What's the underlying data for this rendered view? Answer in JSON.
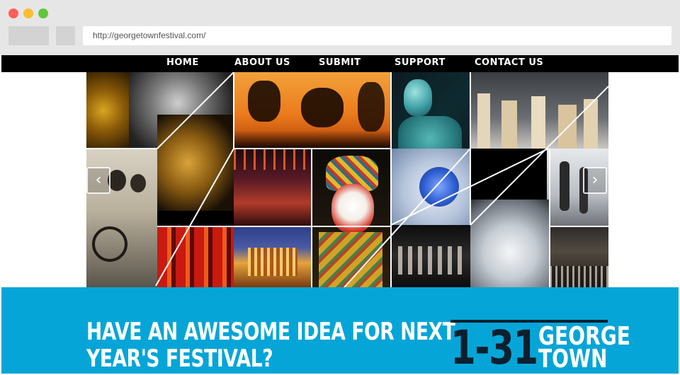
{
  "browser": {
    "url": "http://georgetownfestival.com/",
    "icons": [
      "close-dot",
      "minimize-dot",
      "maximize-dot",
      "back-button",
      "forward-button"
    ]
  },
  "nav": {
    "items": [
      {
        "label": "HOME"
      },
      {
        "label": "ABOUT US"
      },
      {
        "label": "SUBMIT"
      },
      {
        "label": "SUPPORT"
      },
      {
        "label": "CONTACT US"
      }
    ]
  },
  "slider": {
    "prev_icon": "chevron-left-icon",
    "next_icon": "chevron-right-icon",
    "prev_glyph": "‹",
    "next_glyph": "›"
  },
  "banner": {
    "headline_line1": "HAVE AN AWESOME IDEA FOR NEXT",
    "headline_line2": "YEAR'S FESTIVAL?",
    "logo_dates": "1-31",
    "logo_name_line1": "GEORGE",
    "logo_name_line2": "TOWN"
  },
  "colors": {
    "banner": "#06a5d7",
    "nav_bg": "#000000",
    "logo_dark": "#0d1f2d"
  }
}
